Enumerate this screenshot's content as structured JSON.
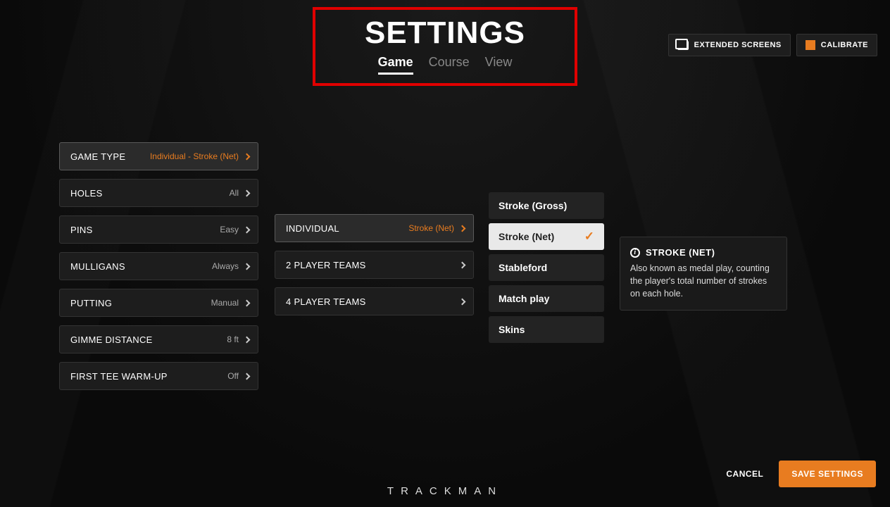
{
  "header": {
    "title": "SETTINGS",
    "tabs": {
      "game": "Game",
      "course": "Course",
      "view": "View"
    },
    "extended": "EXTENDED SCREENS",
    "calibrate": "CALIBRATE"
  },
  "col1": {
    "game_type": {
      "label": "GAME TYPE",
      "value": "Individual  -  Stroke (Net)"
    },
    "holes": {
      "label": "HOLES",
      "value": "All"
    },
    "pins": {
      "label": "PINS",
      "value": "Easy"
    },
    "mulligans": {
      "label": "MULLIGANS",
      "value": "Always"
    },
    "putting": {
      "label": "PUTTING",
      "value": "Manual"
    },
    "gimme": {
      "label": "GIMME DISTANCE",
      "value": "8 ft"
    },
    "warmup": {
      "label": "FIRST TEE WARM-UP",
      "value": "Off"
    }
  },
  "col2": {
    "individual": {
      "label": "INDIVIDUAL",
      "value": "Stroke (Net)"
    },
    "two_team": {
      "label": "2 PLAYER TEAMS",
      "value": ""
    },
    "four_team": {
      "label": "4 PLAYER TEAMS",
      "value": ""
    }
  },
  "col3": {
    "opts": [
      "Stroke (Gross)",
      "Stroke (Net)",
      "Stableford",
      "Match play",
      "Skins"
    ]
  },
  "info": {
    "title": "STROKE (NET)",
    "body": "Also known as medal play, counting the player's total number of strokes on each hole."
  },
  "footer": {
    "brand": "TRACKMAN",
    "cancel": "CANCEL",
    "save": "SAVE SETTINGS"
  }
}
